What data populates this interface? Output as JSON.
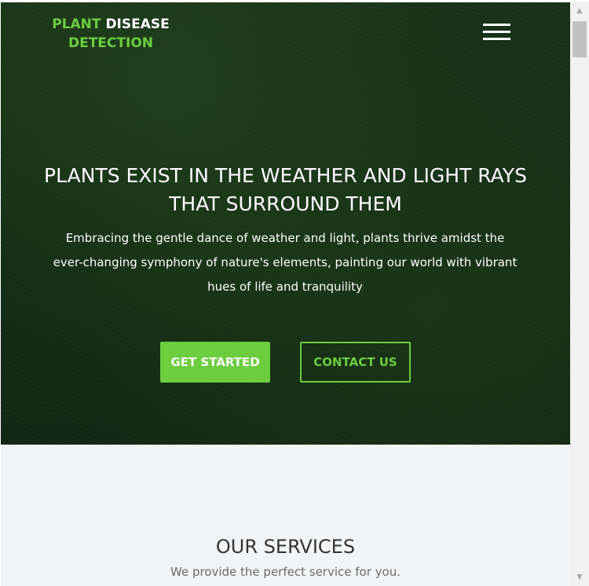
{
  "header": {
    "logo": {
      "line1_green": "PLANT",
      "line1_white": "DISEASE",
      "line2_green": "DETECTION"
    },
    "menu_icon": "hamburger-menu-icon"
  },
  "hero": {
    "title_line1": "PLANTS EXIST IN THE WEATHER AND LIGHT RAYS",
    "title_line2": "THAT SURROUND THEM",
    "text": "Embracing the gentle dance of weather and light, plants thrive amidst the ever-changing symphony of nature's elements, painting our world with vibrant hues of life and tranquility",
    "get_started_label": "GET STARTED",
    "contact_label": "CONTACT US"
  },
  "services": {
    "title": "OUR SERVICES",
    "subtitle": "We provide the perfect service for you."
  },
  "scrollbar": {
    "up_icon": "chevron-up-icon",
    "down_icon": "chevron-down-icon"
  },
  "colors": {
    "accent": "#6ccd3f",
    "hero_bg": "#1c3a1a",
    "section_bg": "#f3f4f5"
  }
}
